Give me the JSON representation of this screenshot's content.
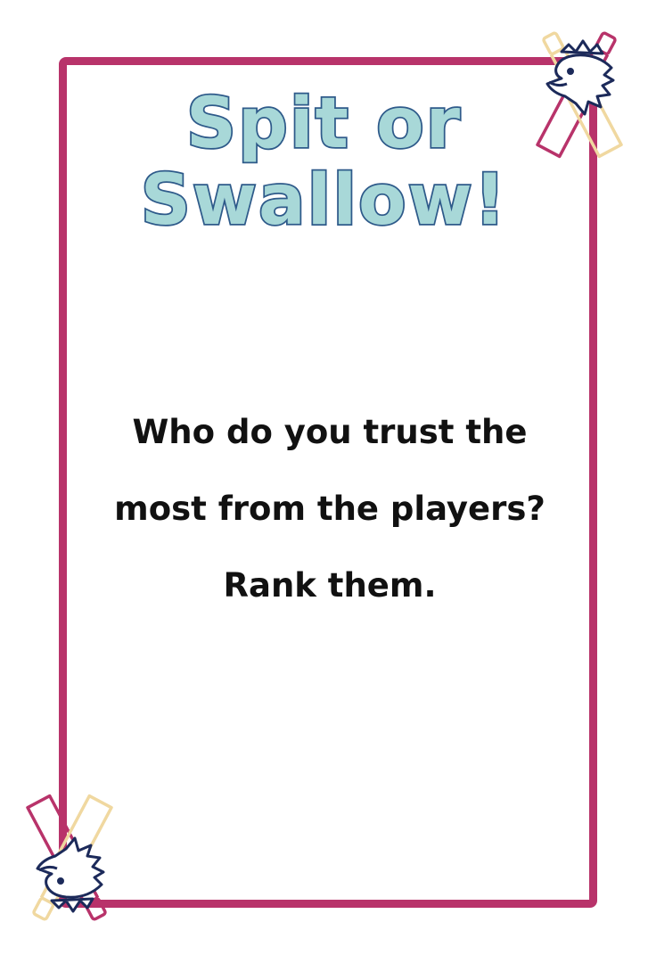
{
  "card": {
    "title_line_1": "Spit or",
    "title_line_2": "Swallow!",
    "prompt_line_1": "Who do you trust the",
    "prompt_line_2": "most from the players?",
    "prompt_line_3": "Rank them."
  },
  "colors": {
    "frame": "#b8336a",
    "title_fill": "#a8d8d8",
    "title_outline": "#2e5a8a",
    "text": "#111111",
    "bottle_magenta": "#b8336a",
    "bottle_tan": "#f0d8a0",
    "emblem_outline": "#1c2a5a"
  },
  "decorations": {
    "top_right_icon": "crossed-bottles-eagle-icon",
    "bottom_left_icon": "crossed-bottles-eagle-icon"
  }
}
